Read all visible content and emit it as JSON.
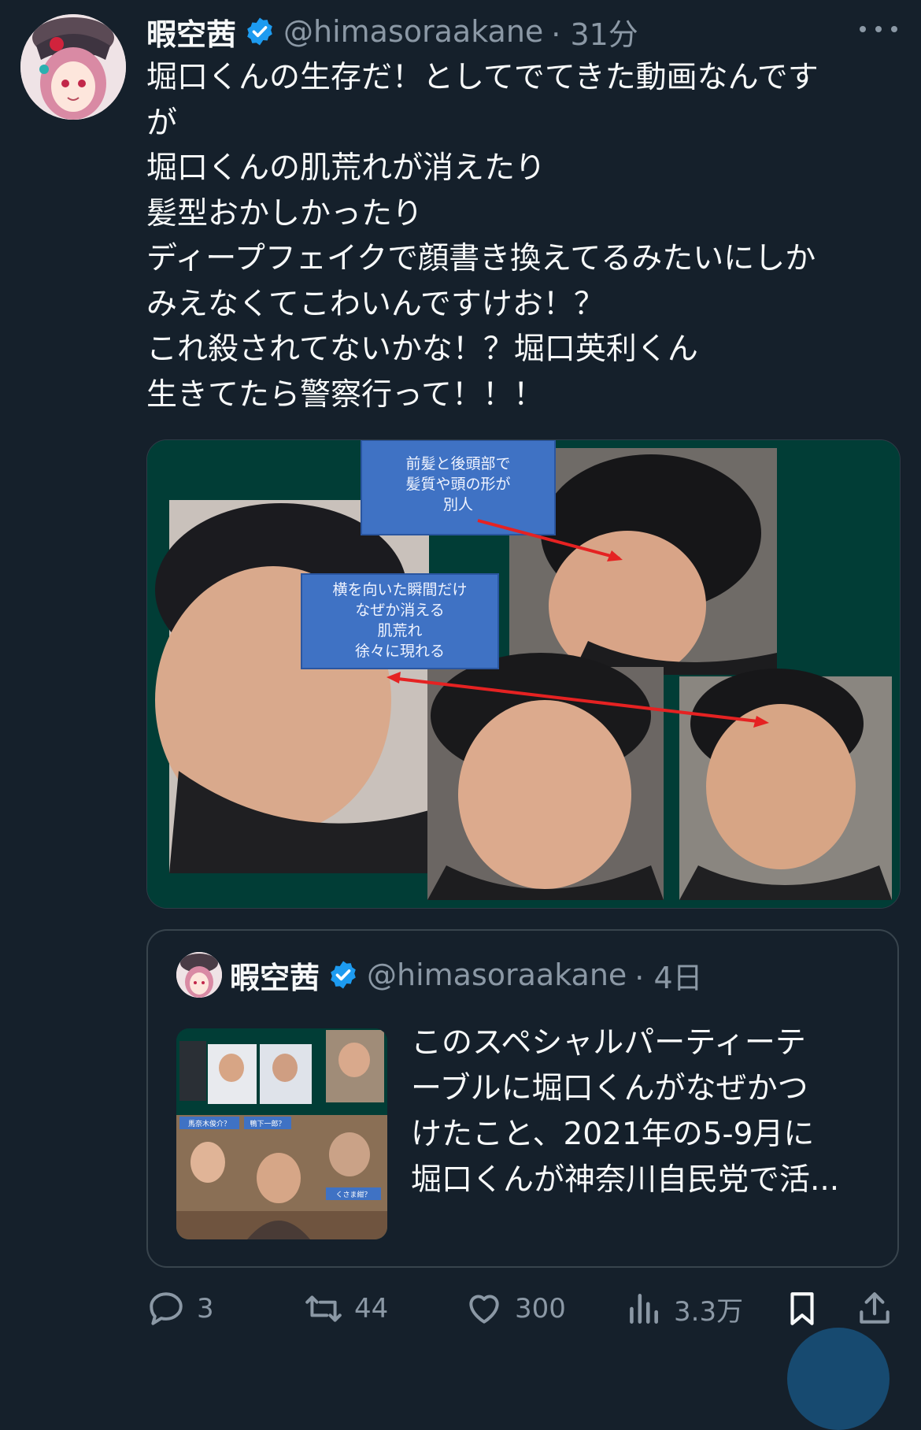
{
  "tweet": {
    "author_name": "暇空茜",
    "handle": "@himasoraakane",
    "time": "· 31分",
    "text": "堀口くんの生存だ！としてでてきた動画なんです\nが\n堀口くんの肌荒れが消えたり\n髪型おかしかったり\nディープフェイクで顔書き換えてるみたいにしか\nみえなくてこわいんですけお！？\nこれ殺されてないかな！？堀口英利くん\n生きてたら警察行って！！！"
  },
  "media": {
    "label_top": [
      "前髪と後頭部で",
      "髪質や頭の形が",
      "別人"
    ],
    "label_mid": [
      "横を向いた瞬間だけ",
      "なぜか消える",
      "肌荒れ",
      "徐々に現れる"
    ]
  },
  "quote": {
    "author_name": "暇空茜",
    "handle": "@himasoraakane",
    "time": "· 4日",
    "text": "このスペシャルパーティーテ\nーブルに堀口くんがなぜかつ\nけたこと、2021年の5-9月に\n堀口くんが神奈川自民党で活...",
    "thumb_labels": [
      "馬奈木俊介？",
      "鴨下一郎？",
      "くさま紺？"
    ]
  },
  "actions": {
    "replies": "3",
    "retweets": "44",
    "likes": "300",
    "views": "3.3万"
  },
  "colors": {
    "background": "#15202b",
    "text": "#f7f9f9",
    "secondary": "#8b98a5",
    "verified": "#1d9bf0",
    "media_bg": "#013d36"
  },
  "icons": [
    "more-icon",
    "verified-icon",
    "reply-icon",
    "retweet-icon",
    "like-icon",
    "views-icon",
    "bookmark-icon",
    "share-icon"
  ]
}
